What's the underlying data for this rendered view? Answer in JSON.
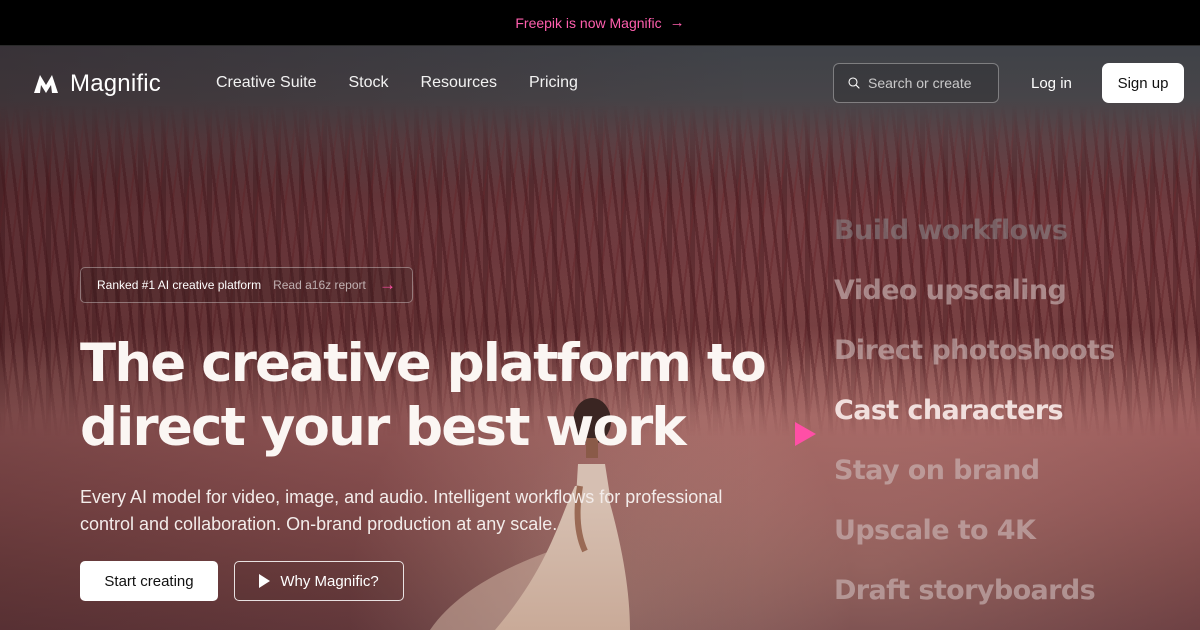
{
  "promo": {
    "text": "Freepik is now Magnific",
    "arrow": "→"
  },
  "nav": {
    "logo_text": "Magnific",
    "links": [
      "Creative Suite",
      "Stock",
      "Resources",
      "Pricing"
    ],
    "search_placeholder": "Search or create",
    "login_label": "Log in",
    "signup_label": "Sign up"
  },
  "hero": {
    "badge": {
      "label": "Ranked #1 AI creative platform",
      "link": "Read a16z report"
    },
    "headline": "The creative platform to direct your best work",
    "subtext": "Every AI model for video, image, and audio. Intelligent workflows for professional control and collaboration. On-brand production at any scale.",
    "primary_cta": "Start creating",
    "secondary_cta": "Why Magnific?"
  },
  "rotator": {
    "active_index": 3,
    "items": [
      "Build workflows",
      "Video upscaling",
      "Direct photoshoots",
      "Cast characters",
      "Stay on brand",
      "Upscale to 4K",
      "Draft storyboards"
    ]
  },
  "colors": {
    "accent_pink": "#ff4fa6",
    "promo_pink": "#ff5fae",
    "bar_bg": "#000000"
  },
  "icons": {
    "promo_arrow": "arrow-right-icon",
    "logo": "magnific-logo-icon",
    "search": "search-icon",
    "badge_arrow": "arrow-right-icon",
    "play": "play-icon",
    "pointer": "triangle-pointer-icon"
  }
}
